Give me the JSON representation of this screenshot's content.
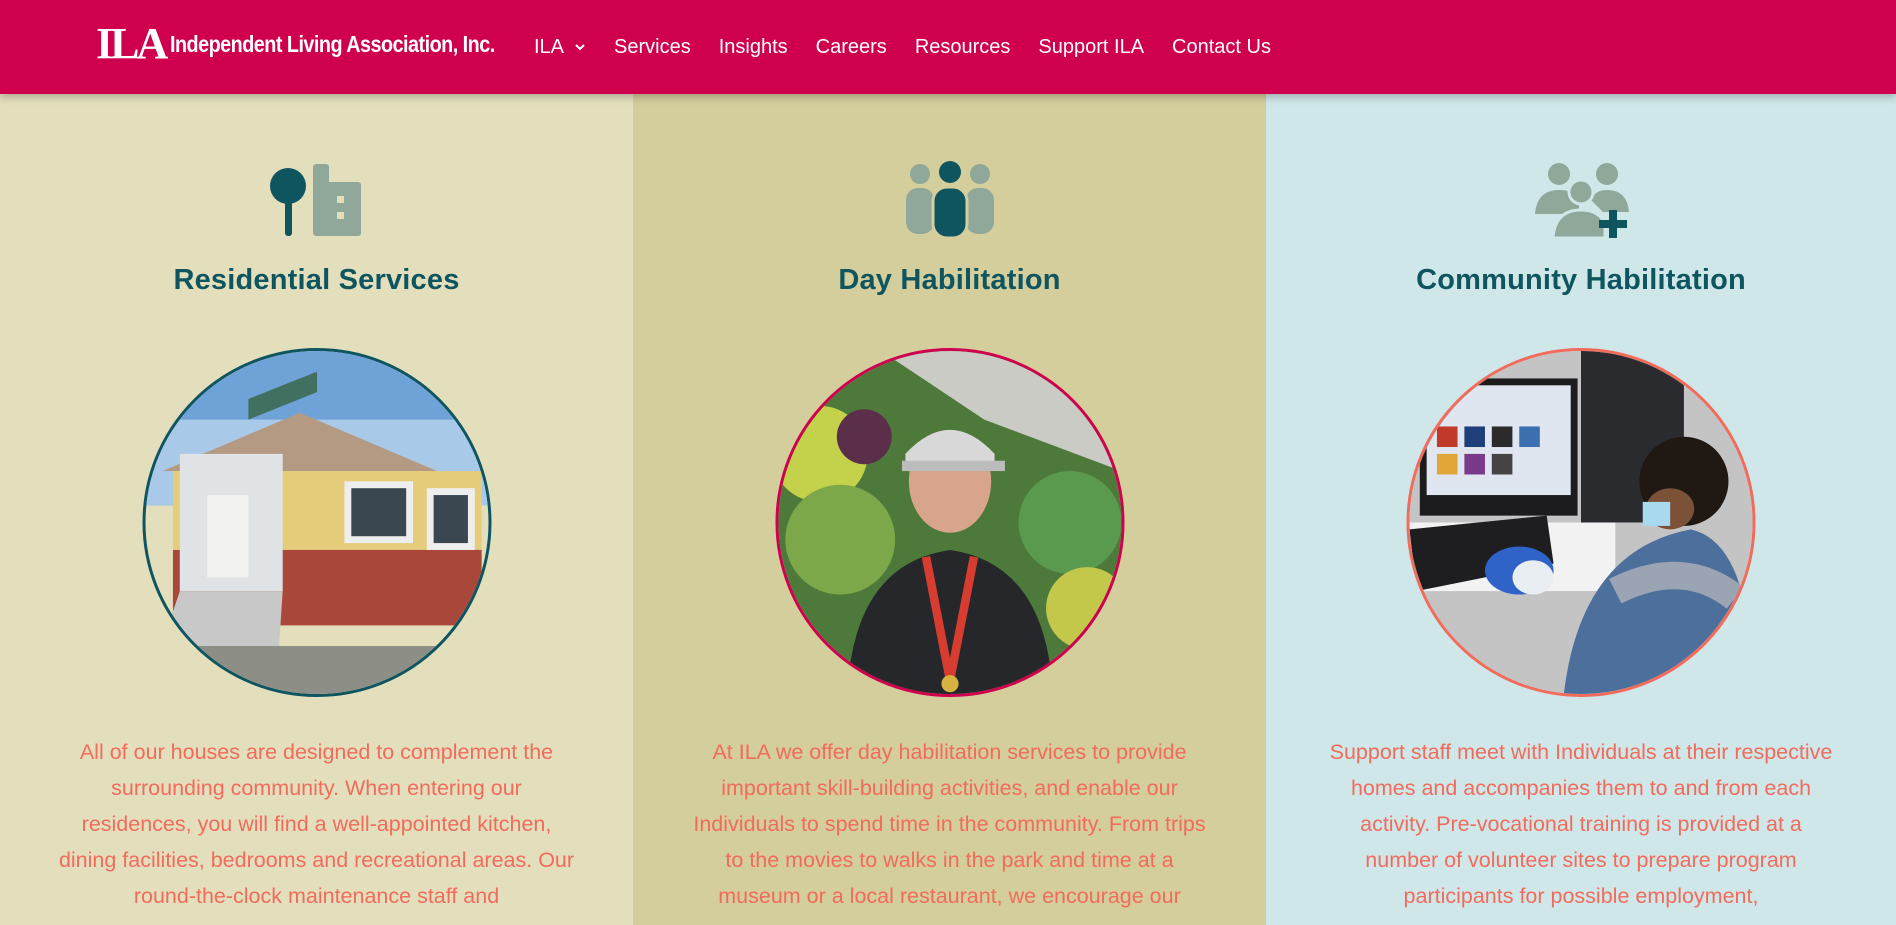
{
  "brand": {
    "logo_mark": "ILA",
    "name": "Independent Living Association, Inc."
  },
  "nav": {
    "items": [
      {
        "label": "ILA",
        "has_dropdown": true
      },
      {
        "label": "Services"
      },
      {
        "label": "Insights"
      },
      {
        "label": "Careers"
      },
      {
        "label": "Resources"
      },
      {
        "label": "Support ILA"
      },
      {
        "label": "Contact Us"
      }
    ]
  },
  "colors": {
    "header_bg": "#cf004d",
    "title_color": "#0f5560",
    "body_text": "#f26b5b",
    "col1_bg": "#e3dfbd",
    "col2_bg": "#d4cd9c",
    "col3_bg": "#cfe7e8"
  },
  "columns": [
    {
      "icon": "tree-building-icon",
      "title": "Residential Services",
      "photo": "house-photo",
      "text": "All of our houses are designed to complement the surrounding community. When entering our residences, you will find a well-appointed kitchen, dining facilities, bedrooms and recreational areas. Our round-the-clock maintenance staff and"
    },
    {
      "icon": "group-people-icon",
      "title": "Day Habilitation",
      "photo": "man-greenhouse-photo",
      "text": "At ILA we offer day habilitation services to provide important skill-building activities, and enable our Individuals to spend time in the community. From trips to the movies to walks in the park and time at a museum or a local restaurant, we encourage our"
    },
    {
      "icon": "add-user-group-icon",
      "title": "Community Habilitation",
      "photo": "person-computer-photo",
      "text": "Support staff meet with Individuals at their respective homes and accompanies them to and from each activity. Pre-vocational training is provided at a number of volunteer sites to prepare program participants for possible employment,"
    }
  ]
}
